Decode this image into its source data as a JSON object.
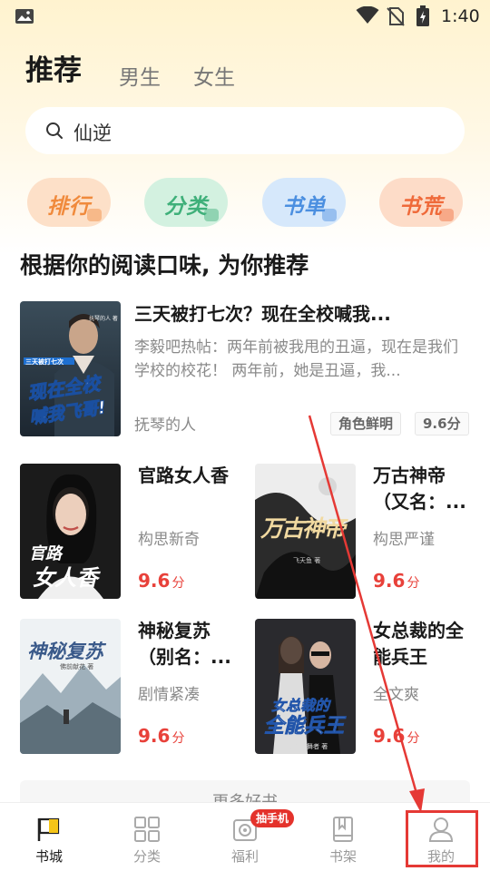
{
  "status_bar": {
    "time": "1:40"
  },
  "header": {
    "tabs": [
      {
        "label": "推荐"
      },
      {
        "label": "男生"
      },
      {
        "label": "女生"
      }
    ]
  },
  "search": {
    "value": "仙逆"
  },
  "quick_buttons": [
    {
      "label": "排行",
      "color": "#f08a3c",
      "bg": "#fde0c8"
    },
    {
      "label": "分类",
      "color": "#3fb07a",
      "bg": "#d3f1e0"
    },
    {
      "label": "书单",
      "color": "#4b8fe0",
      "bg": "#d6e8fb"
    },
    {
      "label": "书荒",
      "color": "#ef6a3a",
      "bg": "#fddcc8"
    }
  ],
  "section": {
    "title": "根据你的阅读口味, 为你推荐"
  },
  "featured": {
    "title": "三天被打七次？现在全校喊我...",
    "description": "李毅吧热帖：两年前被我甩的丑逼，现在是我们学校的校花！ 两年前，她是丑逼，我...",
    "author": "抚琴的人",
    "tags": [
      "角色鲜明",
      "9.6分"
    ],
    "cover_text": [
      "现在全校",
      "喊我飞哥!"
    ],
    "cover_author": "抚琴的人 著",
    "cover_banner": "三天被打七次"
  },
  "books": [
    {
      "title": "官路女人香",
      "meta": "构思新奇",
      "score": "9.6",
      "unit": "分",
      "cover_text": [
        "官路",
        "女人香"
      ]
    },
    {
      "title": "万古神帝（又名：...",
      "meta": "构思严谨",
      "score": "9.6",
      "unit": "分",
      "cover_text": [
        "万古神帝"
      ],
      "cover_author": "飞天鱼 著"
    },
    {
      "title": "神秘复苏（别名：...",
      "meta": "剧情紧凑",
      "score": "9.6",
      "unit": "分",
      "cover_text": [
        "神秘复苏"
      ],
      "cover_author": "佛前献花 著"
    },
    {
      "title": "女总裁的全能兵王",
      "meta": "全文爽",
      "score": "9.6",
      "unit": "分",
      "cover_text": [
        "女总裁的",
        "全能兵王"
      ],
      "cover_author": "寂寞的舞者 著"
    }
  ],
  "more": {
    "label": "更多好书"
  },
  "bottom_nav": [
    {
      "label": "书城",
      "icon": "flag-icon"
    },
    {
      "label": "分类",
      "icon": "grid-icon"
    },
    {
      "label": "福利",
      "icon": "gift-icon",
      "badge": "抽手机"
    },
    {
      "label": "书架",
      "icon": "book-icon"
    },
    {
      "label": "我的",
      "icon": "user-icon"
    }
  ]
}
